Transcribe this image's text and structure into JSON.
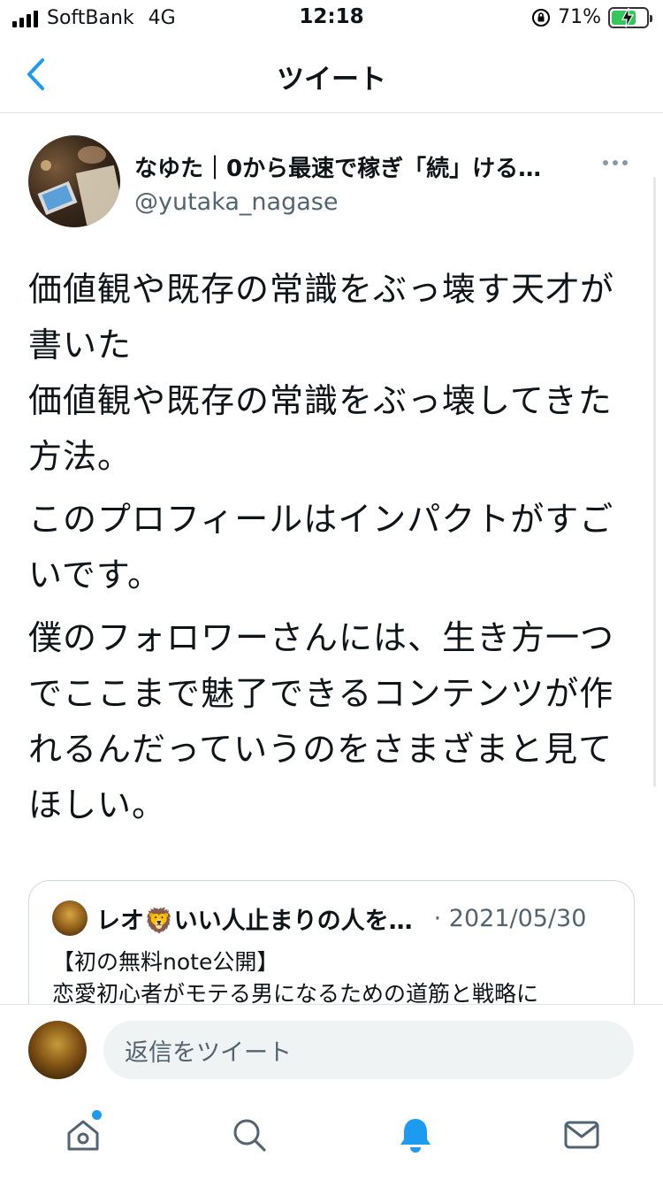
{
  "status_bar": {
    "carrier": "SoftBank",
    "network": "4G",
    "time": "12:18",
    "battery_percent": "71%",
    "battery_level": 0.71
  },
  "nav": {
    "title": "ツイート",
    "back_icon": "chevron-left-icon"
  },
  "tweet": {
    "author_name": "なゆた｜0から最速で稼ぎ「続」ける…",
    "author_handle": "@yutaka_nagase",
    "paragraphs": [
      "価値観や既存の常識をぶっ壊す天才が書いた\n価値観や既存の常識をぶっ壊してきた方法。",
      "このプロフィールはインパクトがすごいです。",
      "僕のフォロワーさんには、生き方一つでここまで魅了できるコンテンツが作れるんだっていうのをさまざまと見てほしい。"
    ]
  },
  "quote": {
    "author_name": "レオ🦁いい人止まりの人を…",
    "date": "· 2021/05/30",
    "line1": "【初の無料note公開】",
    "line2": "恋愛初心者がモテる男になるための道筋と戦略に"
  },
  "reply": {
    "placeholder": "返信をツイート"
  },
  "tabs": [
    {
      "name": "home",
      "icon": "home-icon"
    },
    {
      "name": "search",
      "icon": "search-icon"
    },
    {
      "name": "notifications",
      "icon": "bell-icon"
    },
    {
      "name": "messages",
      "icon": "mail-icon"
    }
  ],
  "colors": {
    "accent": "#1d9bf0",
    "secondary_text": "#536471",
    "battery_green": "#34c759"
  }
}
